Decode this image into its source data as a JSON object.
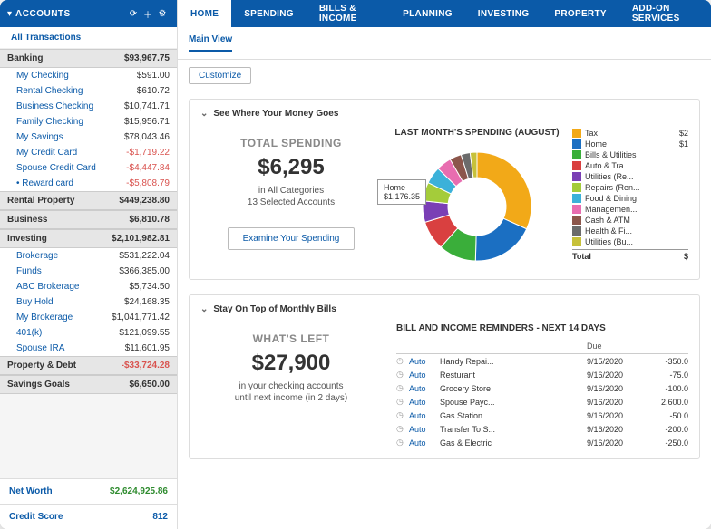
{
  "sidebar": {
    "title": "ACCOUNTS",
    "all_transactions": "All Transactions",
    "categories": [
      {
        "name": "Banking",
        "total": "$93,967.75",
        "expanded": true,
        "rows": [
          {
            "name": "My Checking",
            "amt": "$591.00"
          },
          {
            "name": "Rental Checking",
            "amt": "$610.72"
          },
          {
            "name": "Business Checking",
            "amt": "$10,741.71"
          },
          {
            "name": "Family Checking",
            "amt": "$15,956.71"
          },
          {
            "name": "My Savings",
            "amt": "$78,043.46"
          },
          {
            "name": "My Credit Card",
            "amt": "-$1,719.22",
            "neg": true
          },
          {
            "name": "Spouse Credit Card",
            "amt": "-$4,447.84",
            "neg": true
          },
          {
            "name": "Reward card",
            "amt": "-$5,808.79",
            "neg": true,
            "dot": true
          }
        ]
      },
      {
        "name": "Rental Property",
        "total": "$449,238.80",
        "expanded": false
      },
      {
        "name": "Business",
        "total": "$6,810.78",
        "expanded": false
      },
      {
        "name": "Investing",
        "total": "$2,101,982.81",
        "expanded": true,
        "rows": [
          {
            "name": "Brokerage",
            "amt": "$531,222.04"
          },
          {
            "name": "Funds",
            "amt": "$366,385.00"
          },
          {
            "name": "ABC Brokerage",
            "amt": "$5,734.50"
          },
          {
            "name": "Buy Hold",
            "amt": "$24,168.35"
          },
          {
            "name": "My Brokerage",
            "amt": "$1,041,771.42"
          },
          {
            "name": "401(k)",
            "amt": "$121,099.55"
          },
          {
            "name": "Spouse IRA",
            "amt": "$11,601.95"
          }
        ]
      },
      {
        "name": "Property & Debt",
        "total": "-$33,724.28",
        "neg": true,
        "expanded": false
      },
      {
        "name": "Savings Goals",
        "total": "$6,650.00",
        "expanded": false
      }
    ],
    "net_worth": {
      "label": "Net Worth",
      "value": "$2,624,925.86"
    },
    "credit_score": {
      "label": "Credit Score",
      "value": "812"
    }
  },
  "tabs": [
    "HOME",
    "SPENDING",
    "BILLS & INCOME",
    "PLANNING",
    "INVESTING",
    "PROPERTY",
    "ADD-ON SERVICES"
  ],
  "active_tab": 0,
  "main_view": "Main View",
  "customize": "Customize",
  "spending": {
    "panel_title": "See Where Your Money Goes",
    "total_label": "TOTAL SPENDING",
    "total_amount": "$6,295",
    "sub1": "in All Categories",
    "sub2": "13 Selected Accounts",
    "examine": "Examine Your Spending",
    "chart_title": "LAST MONTH'S SPENDING (AUGUST)",
    "tooltip": {
      "label": "Home",
      "value": "$1,176.35"
    }
  },
  "legend": [
    {
      "color": "#f2a918",
      "name": "Tax",
      "v": "$2"
    },
    {
      "color": "#1b6fc2",
      "name": "Home",
      "v": "$1"
    },
    {
      "color": "#3aae3a",
      "name": "Bills & Utilities",
      "v": ""
    },
    {
      "color": "#d94040",
      "name": "Auto & Tra...",
      "v": ""
    },
    {
      "color": "#7a3fb5",
      "name": "Utilities (Re...",
      "v": ""
    },
    {
      "color": "#a4cc3a",
      "name": "Repairs (Ren...",
      "v": ""
    },
    {
      "color": "#3bb1d9",
      "name": "Food & Dining",
      "v": ""
    },
    {
      "color": "#e86db0",
      "name": "Managemen...",
      "v": ""
    },
    {
      "color": "#8c564b",
      "name": "Cash & ATM",
      "v": ""
    },
    {
      "color": "#6b6b6b",
      "name": "Health & Fi...",
      "v": ""
    },
    {
      "color": "#c7c13a",
      "name": "Utilities (Bu...",
      "v": ""
    }
  ],
  "legend_total": {
    "label": "Total",
    "v": "$"
  },
  "bills": {
    "panel_title": "Stay On Top of Monthly Bills",
    "left_label": "WHAT'S LEFT",
    "left_amount": "$27,900",
    "left_sub1": "in your checking accounts",
    "left_sub2": "until next income (in 2 days)",
    "right_title": "BILL AND INCOME REMINDERS - NEXT 14 DAYS",
    "due_label": "Due",
    "auto": "Auto",
    "rows": [
      {
        "name": "Handy Repai...",
        "due": "9/15/2020",
        "amt": "-350.0"
      },
      {
        "name": "Resturant",
        "due": "9/16/2020",
        "amt": "-75.0"
      },
      {
        "name": "Grocery Store",
        "due": "9/16/2020",
        "amt": "-100.0"
      },
      {
        "name": "Spouse Payc...",
        "due": "9/16/2020",
        "amt": "2,600.0"
      },
      {
        "name": "Gas Station",
        "due": "9/16/2020",
        "amt": "-50.0"
      },
      {
        "name": "Transfer To S...",
        "due": "9/16/2020",
        "amt": "-200.0"
      },
      {
        "name": "Gas & Electric",
        "due": "9/16/2020",
        "amt": "-250.0"
      }
    ]
  },
  "chart_data": {
    "type": "pie",
    "title": "LAST MONTH'S SPENDING (AUGUST)",
    "total": 6295,
    "series": [
      {
        "name": "Tax",
        "value": 2000,
        "color": "#f2a918"
      },
      {
        "name": "Home",
        "value": 1176.35,
        "color": "#1b6fc2"
      },
      {
        "name": "Bills & Utilities",
        "value": 700,
        "color": "#3aae3a"
      },
      {
        "name": "Auto & Transport",
        "value": 550,
        "color": "#d94040"
      },
      {
        "name": "Utilities (Rental)",
        "value": 400,
        "color": "#7a3fb5"
      },
      {
        "name": "Repairs (Rental)",
        "value": 350,
        "color": "#a4cc3a"
      },
      {
        "name": "Food & Dining",
        "value": 320,
        "color": "#3bb1d9"
      },
      {
        "name": "Management",
        "value": 280,
        "color": "#e86db0"
      },
      {
        "name": "Cash & ATM",
        "value": 220,
        "color": "#8c564b"
      },
      {
        "name": "Health & Fitness",
        "value": 170,
        "color": "#6b6b6b"
      },
      {
        "name": "Utilities (Business)",
        "value": 128.65,
        "color": "#c7c13a"
      }
    ]
  }
}
